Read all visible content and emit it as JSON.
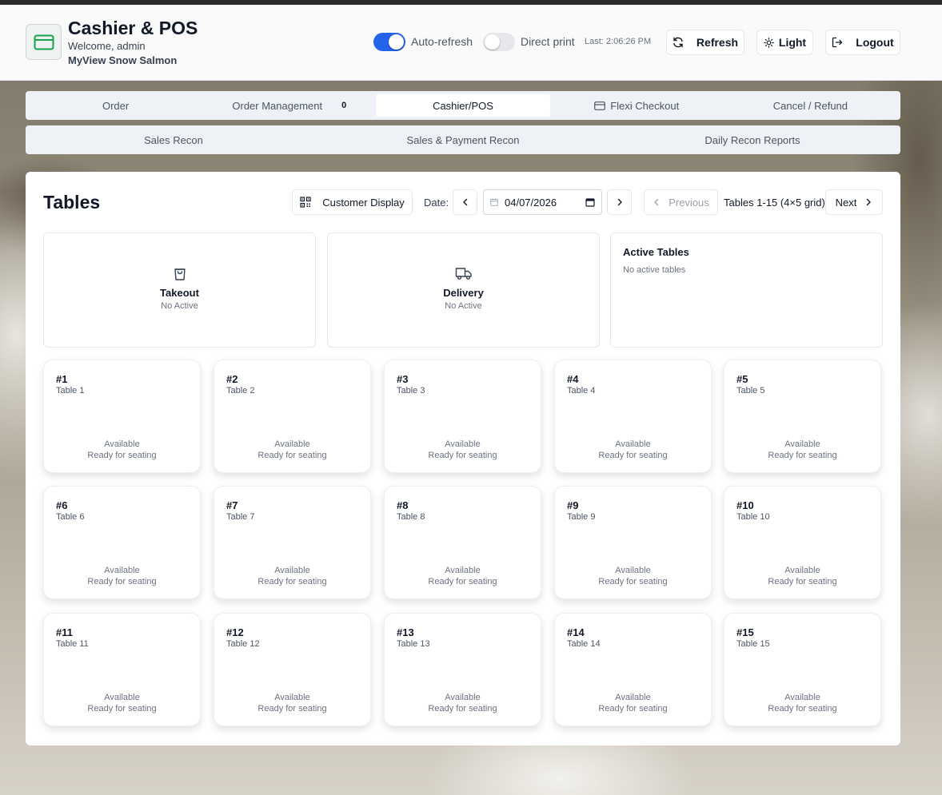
{
  "app": {
    "title": "Cashier & POS",
    "welcome": "Welcome, admin",
    "store": "MyView Snow Salmon",
    "accent": "#2563eb",
    "logo_color": "#16a34a"
  },
  "header": {
    "auto_refresh": {
      "label": "Auto-refresh",
      "on": true
    },
    "direct_print": {
      "label": "Direct print",
      "on": false
    },
    "last_updated": "Last: 2:06:26 PM",
    "refresh_label": "Refresh",
    "theme_label": "Light",
    "logout_label": "Logout"
  },
  "tabs": [
    {
      "label": "Order"
    },
    {
      "label": "Order Management",
      "count": "0"
    },
    {
      "label": "Cashier/POS",
      "active": true
    },
    {
      "label": "Flexi Checkout",
      "icon": "card-icon"
    },
    {
      "label": "Cancel / Refund"
    }
  ],
  "subtabs": [
    {
      "label": "Sales Recon"
    },
    {
      "label": "Sales & Payment Recon"
    },
    {
      "label": "Daily Recon Reports"
    }
  ],
  "tables_panel": {
    "title": "Tables",
    "customer_display_label": "Customer Display",
    "date_label": "Date:",
    "date_value": "04/07/2026",
    "previous_label": "Previous",
    "range_label": "Tables 1-15 (4×5 grid)",
    "next_label": "Next"
  },
  "summary": {
    "takeout": {
      "title": "Takeout",
      "sub": "No Active"
    },
    "delivery": {
      "title": "Delivery",
      "sub": "No Active"
    },
    "active": {
      "title": "Active Tables",
      "sub": "No active tables"
    }
  },
  "tables": [
    {
      "num": "#1",
      "name": "Table 1",
      "status": "Available",
      "sub": "Ready for seating"
    },
    {
      "num": "#2",
      "name": "Table 2",
      "status": "Available",
      "sub": "Ready for seating"
    },
    {
      "num": "#3",
      "name": "Table 3",
      "status": "Available",
      "sub": "Ready for seating"
    },
    {
      "num": "#4",
      "name": "Table 4",
      "status": "Available",
      "sub": "Ready for seating"
    },
    {
      "num": "#5",
      "name": "Table 5",
      "status": "Available",
      "sub": "Ready for seating"
    },
    {
      "num": "#6",
      "name": "Table 6",
      "status": "Available",
      "sub": "Ready for seating"
    },
    {
      "num": "#7",
      "name": "Table 7",
      "status": "Available",
      "sub": "Ready for seating"
    },
    {
      "num": "#8",
      "name": "Table 8",
      "status": "Available",
      "sub": "Ready for seating"
    },
    {
      "num": "#9",
      "name": "Table 9",
      "status": "Available",
      "sub": "Ready for seating"
    },
    {
      "num": "#10",
      "name": "Table 10",
      "status": "Available",
      "sub": "Ready for seating"
    },
    {
      "num": "#11",
      "name": "Table 11",
      "status": "Available",
      "sub": "Ready for seating"
    },
    {
      "num": "#12",
      "name": "Table 12",
      "status": "Available",
      "sub": "Ready for seating"
    },
    {
      "num": "#13",
      "name": "Table 13",
      "status": "Available",
      "sub": "Ready for seating"
    },
    {
      "num": "#14",
      "name": "Table 14",
      "status": "Available",
      "sub": "Ready for seating"
    },
    {
      "num": "#15",
      "name": "Table 15",
      "status": "Available",
      "sub": "Ready for seating"
    }
  ]
}
